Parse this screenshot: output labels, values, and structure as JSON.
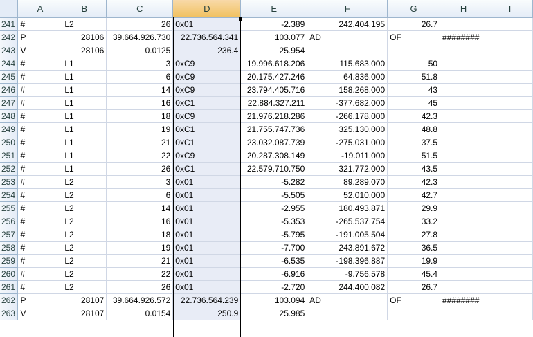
{
  "columns": [
    "A",
    "B",
    "C",
    "D",
    "E",
    "F",
    "G",
    "H",
    "I"
  ],
  "selected_column": "D",
  "rows": [
    {
      "n": "241",
      "a": "#",
      "b": "L2",
      "c": "26",
      "d": "0x01",
      "e": "-2.389",
      "f": "242.404.195",
      "g": "26.7",
      "h": "",
      "i": ""
    },
    {
      "n": "242",
      "a": "P",
      "b": "28106",
      "c": "39.664.926.730",
      "d": "22.736.564.341",
      "e": "103.077",
      "f": "AD",
      "g": "OF",
      "h": "########",
      "i": ""
    },
    {
      "n": "243",
      "a": "V",
      "b": "28106",
      "c": "0.0125",
      "d": "236.4",
      "e": "25.954",
      "f": "",
      "g": "",
      "h": "",
      "i": ""
    },
    {
      "n": "244",
      "a": "#",
      "b": "L1",
      "c": "3",
      "d": "0xC9",
      "e": "19.996.618.206",
      "f": "115.683.000",
      "g": "50",
      "h": "",
      "i": ""
    },
    {
      "n": "245",
      "a": "#",
      "b": "L1",
      "c": "6",
      "d": "0xC9",
      "e": "20.175.427.246",
      "f": "64.836.000",
      "g": "51.8",
      "h": "",
      "i": ""
    },
    {
      "n": "246",
      "a": "#",
      "b": "L1",
      "c": "14",
      "d": "0xC9",
      "e": "23.794.405.716",
      "f": "158.268.000",
      "g": "43",
      "h": "",
      "i": ""
    },
    {
      "n": "247",
      "a": "#",
      "b": "L1",
      "c": "16",
      "d": "0xC1",
      "e": "22.884.327.211",
      "f": "-377.682.000",
      "g": "45",
      "h": "",
      "i": ""
    },
    {
      "n": "248",
      "a": "#",
      "b": "L1",
      "c": "18",
      "d": "0xC9",
      "e": "21.976.218.286",
      "f": "-266.178.000",
      "g": "42.3",
      "h": "",
      "i": ""
    },
    {
      "n": "249",
      "a": "#",
      "b": "L1",
      "c": "19",
      "d": "0xC1",
      "e": "21.755.747.736",
      "f": "325.130.000",
      "g": "48.8",
      "h": "",
      "i": ""
    },
    {
      "n": "250",
      "a": "#",
      "b": "L1",
      "c": "21",
      "d": "0xC1",
      "e": "23.032.087.739",
      "f": "-275.031.000",
      "g": "37.5",
      "h": "",
      "i": ""
    },
    {
      "n": "251",
      "a": "#",
      "b": "L1",
      "c": "22",
      "d": "0xC9",
      "e": "20.287.308.149",
      "f": "-19.011.000",
      "g": "51.5",
      "h": "",
      "i": ""
    },
    {
      "n": "252",
      "a": "#",
      "b": "L1",
      "c": "26",
      "d": "0xC1",
      "e": "22.579.710.750",
      "f": "321.772.000",
      "g": "43.5",
      "h": "",
      "i": ""
    },
    {
      "n": "253",
      "a": "#",
      "b": "L2",
      "c": "3",
      "d": "0x01",
      "e": "-5.282",
      "f": "89.289.070",
      "g": "42.3",
      "h": "",
      "i": ""
    },
    {
      "n": "254",
      "a": "#",
      "b": "L2",
      "c": "6",
      "d": "0x01",
      "e": "-5.505",
      "f": "52.010.000",
      "g": "42.7",
      "h": "",
      "i": ""
    },
    {
      "n": "255",
      "a": "#",
      "b": "L2",
      "c": "14",
      "d": "0x01",
      "e": "-2.955",
      "f": "180.493.871",
      "g": "29.9",
      "h": "",
      "i": ""
    },
    {
      "n": "256",
      "a": "#",
      "b": "L2",
      "c": "16",
      "d": "0x01",
      "e": "-5.353",
      "f": "-265.537.754",
      "g": "33.2",
      "h": "",
      "i": ""
    },
    {
      "n": "257",
      "a": "#",
      "b": "L2",
      "c": "18",
      "d": "0x01",
      "e": "-5.795",
      "f": "-191.005.504",
      "g": "27.8",
      "h": "",
      "i": ""
    },
    {
      "n": "258",
      "a": "#",
      "b": "L2",
      "c": "19",
      "d": "0x01",
      "e": "-7.700",
      "f": "243.891.672",
      "g": "36.5",
      "h": "",
      "i": ""
    },
    {
      "n": "259",
      "a": "#",
      "b": "L2",
      "c": "21",
      "d": "0x01",
      "e": "-6.535",
      "f": "-198.396.887",
      "g": "19.9",
      "h": "",
      "i": ""
    },
    {
      "n": "260",
      "a": "#",
      "b": "L2",
      "c": "22",
      "d": "0x01",
      "e": "-6.916",
      "f": "-9.756.578",
      "g": "45.4",
      "h": "",
      "i": ""
    },
    {
      "n": "261",
      "a": "#",
      "b": "L2",
      "c": "26",
      "d": "0x01",
      "e": "-2.720",
      "f": "244.400.082",
      "g": "26.7",
      "h": "",
      "i": ""
    },
    {
      "n": "262",
      "a": "P",
      "b": "28107",
      "c": "39.664.926.572",
      "d": "22.736.564.239",
      "e": "103.094",
      "f": "AD",
      "g": "OF",
      "h": "########",
      "i": ""
    },
    {
      "n": "263",
      "a": "V",
      "b": "28107",
      "c": "0.0154",
      "d": "250.9",
      "e": "25.985",
      "f": "",
      "g": "",
      "h": "",
      "i": ""
    }
  ]
}
